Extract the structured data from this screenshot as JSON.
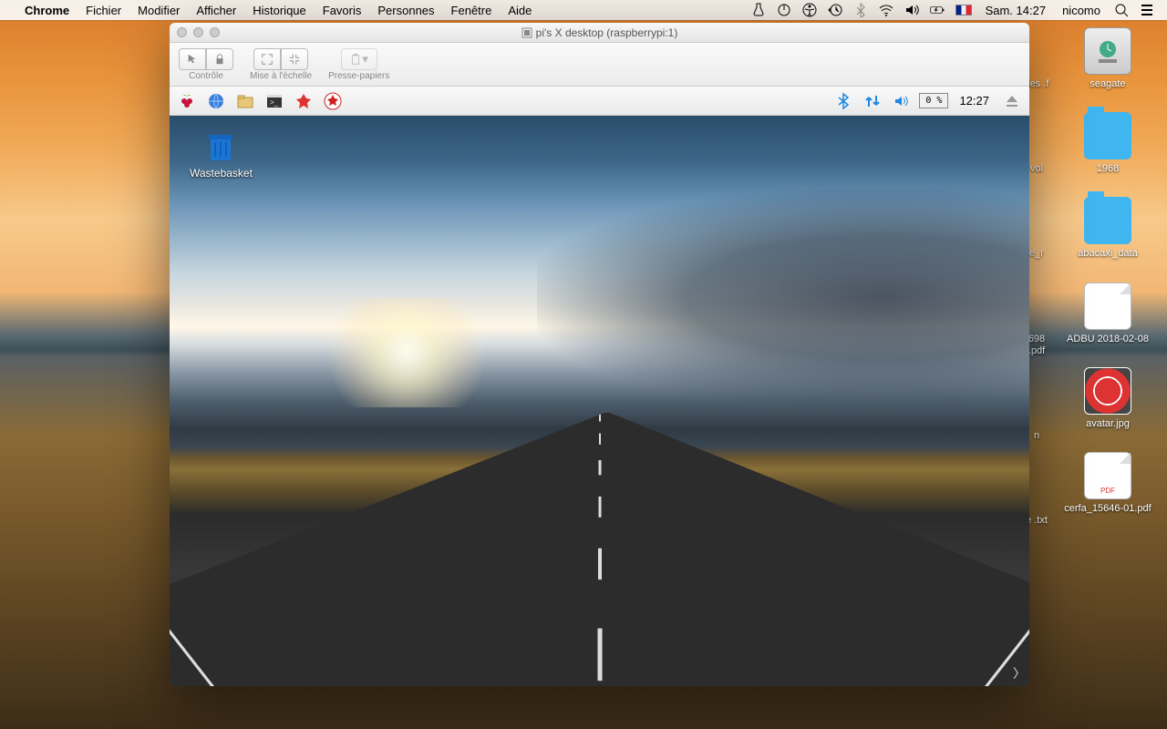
{
  "menubar": {
    "app": "Chrome",
    "items": [
      "Fichier",
      "Modifier",
      "Afficher",
      "Historique",
      "Favoris",
      "Personnes",
      "Fenêtre",
      "Aide"
    ],
    "date": "Sam. 14:27",
    "user": "nicomo"
  },
  "desktop_icons_right": [
    {
      "label": "seagate",
      "kind": "drive"
    },
    {
      "label": "1968",
      "kind": "folder"
    },
    {
      "label": "abacaxi_data",
      "kind": "folder"
    },
    {
      "label": "ADBU 2018-02-08",
      "kind": "doc"
    },
    {
      "label": "avatar.jpg",
      "kind": "img"
    },
    {
      "label": "cerfa_15646-01.pdf",
      "kind": "doc"
    }
  ],
  "desktop_icons_peek": [
    {
      "label": "des\n.f"
    },
    {
      "label": "vol"
    },
    {
      "label": "e_r"
    },
    {
      "label": "698\n.pdf"
    },
    {
      "label": "n"
    },
    {
      "label": "e\n.txt"
    }
  ],
  "vnc": {
    "title": "pi's X desktop (raspberrypi:1)",
    "toolbar": {
      "controle": "Contrôle",
      "echelle": "Mise à l'échelle",
      "presse": "Presse-papiers"
    }
  },
  "pi_panel": {
    "battery": "0 %",
    "clock": "12:27"
  },
  "pi_desktop": {
    "trash": "Wastebasket"
  }
}
